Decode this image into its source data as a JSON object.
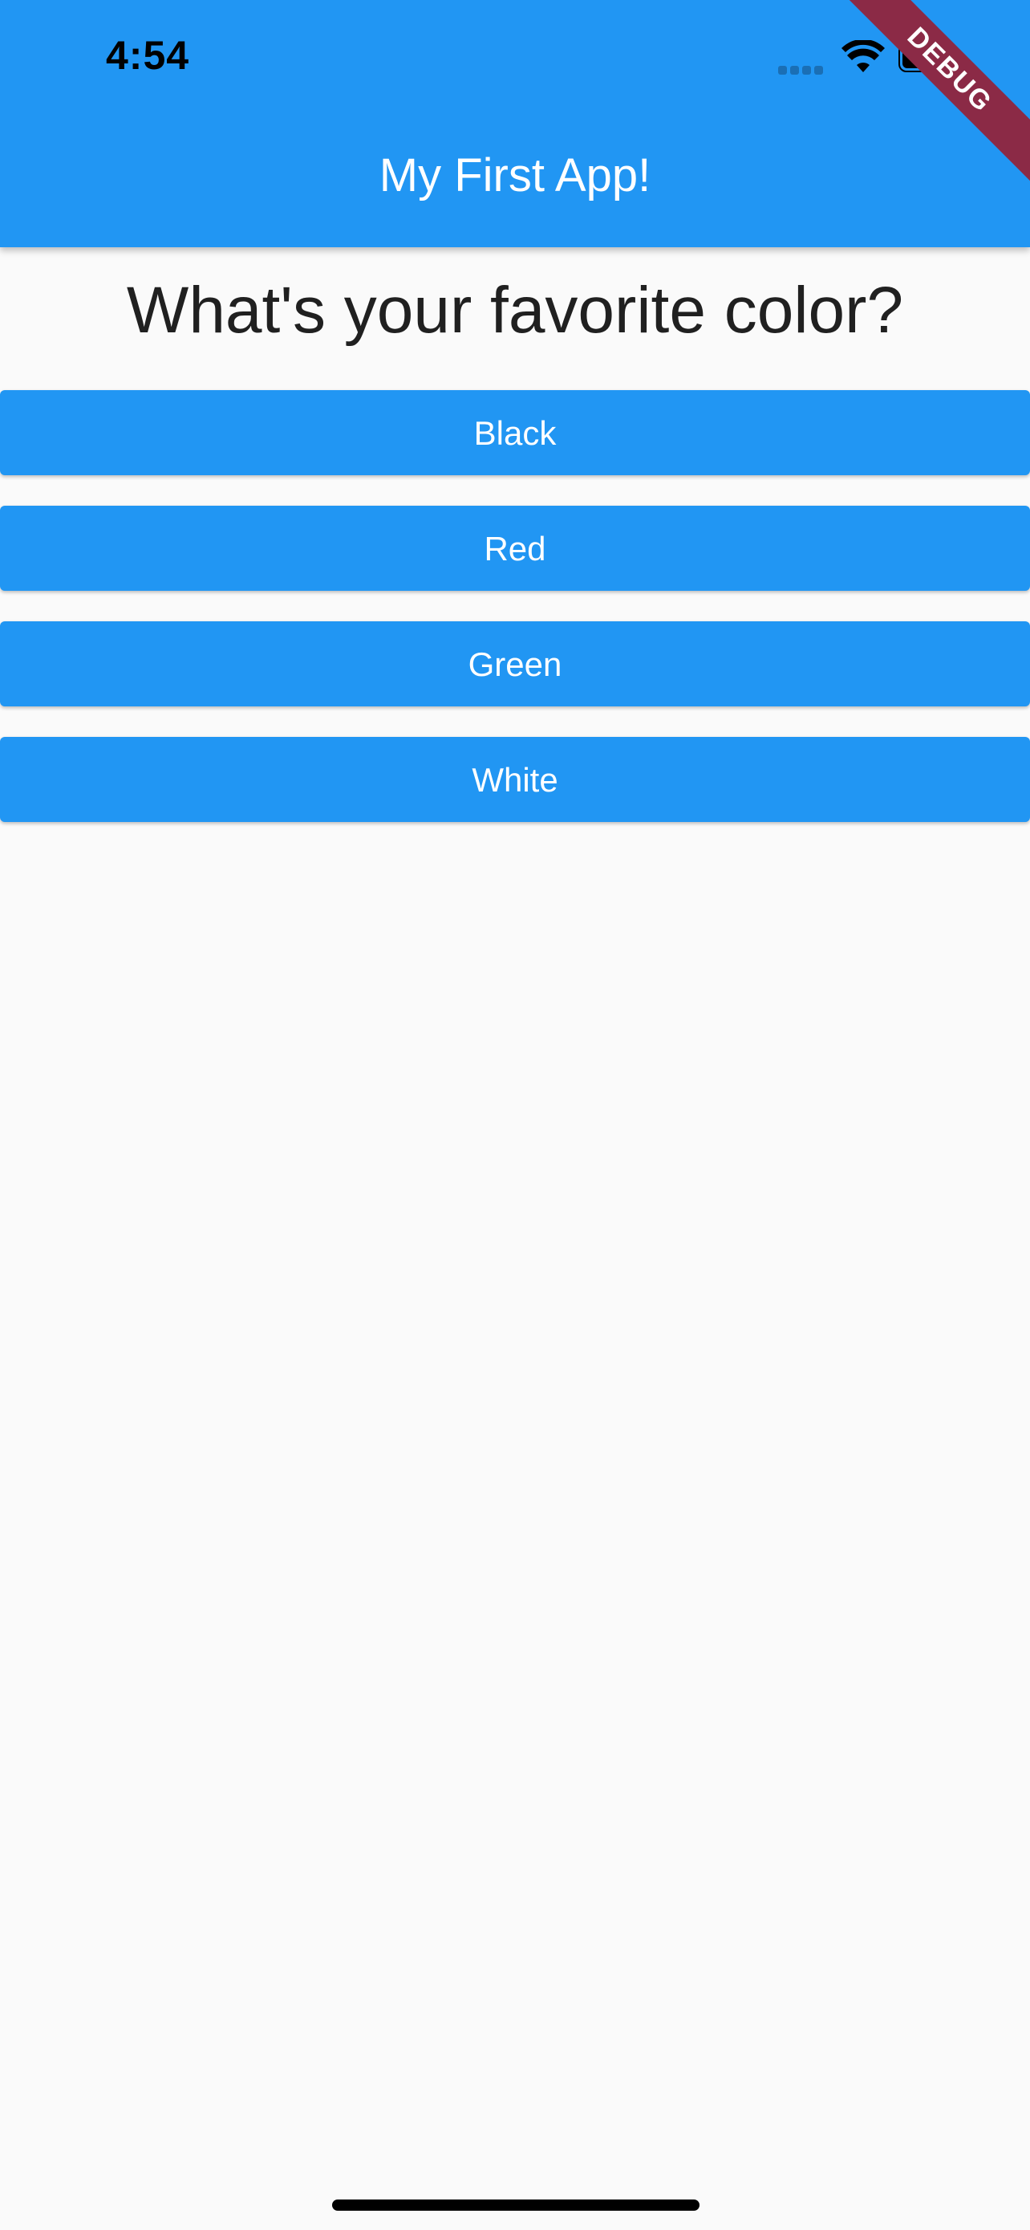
{
  "status_bar": {
    "time": "4:54",
    "icons": [
      "cellular-signal-icon",
      "wifi-icon",
      "battery-icon"
    ]
  },
  "debug_banner": {
    "label": "DEBUG"
  },
  "app_bar": {
    "title": "My First App!"
  },
  "question": {
    "text": "What's your favorite color?"
  },
  "answers": [
    {
      "label": "Black"
    },
    {
      "label": "Red"
    },
    {
      "label": "Green"
    },
    {
      "label": "White"
    }
  ],
  "colors": {
    "primary": "#2196f3",
    "background": "#fafafa",
    "debug_banner": "#8b2a46"
  }
}
